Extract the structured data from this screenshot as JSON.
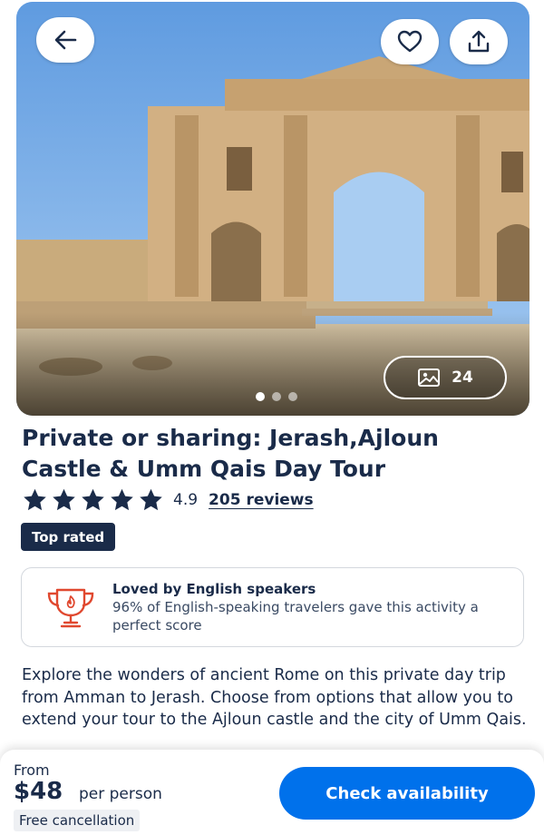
{
  "hero": {
    "photo_count": "24",
    "dots": 3,
    "active_dot": 0
  },
  "title": {
    "line1": "Private or sharing: Jerash,Ajloun",
    "line2": "Castle & Umm Qais Day Tour"
  },
  "rating": {
    "stars": 5,
    "value": "4.9",
    "reviews_label": "205 reviews"
  },
  "badge": "Top rated",
  "loved": {
    "title": "Loved by English speakers",
    "text": "96% of English-speaking travelers gave this activity a perfect score"
  },
  "description": "Explore the wonders of ancient Rome on this private day trip from Amman to Jerash. Choose from options that allow you to extend your tour to the Ajloun castle and the city of Umm Qais.",
  "footer": {
    "from_label": "From",
    "price": "$48",
    "per_person": "per person",
    "free_cancellation": "Free cancellation",
    "cta_label": "Check availability"
  },
  "colors": {
    "primary": "#0071eb",
    "navy": "#1a2b49",
    "accent_red": "#e0482f"
  },
  "icons": [
    "back-arrow-icon",
    "heart-icon",
    "share-icon",
    "image-icon",
    "star-icon",
    "trophy-icon"
  ]
}
